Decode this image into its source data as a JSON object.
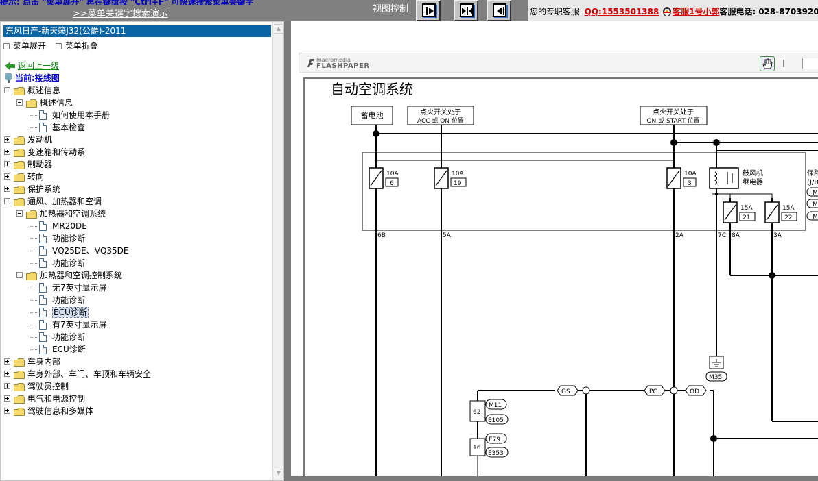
{
  "topbar": {
    "tip": "提示: 点击 \"菜单展开\" 再在键盘按 \"Ctrl+F\" 可快速搜索菜单关键字",
    "demo_link": ">>菜单关键字搜索演示",
    "view_label": "视图控制"
  },
  "service": {
    "prefix": "您的专职客服",
    "qq": "QQ:1553501388",
    "cs_name": "客服1号小郭",
    "tel_label": "客服电话:",
    "tel": "028-8703920"
  },
  "left": {
    "model": "东风日产-新天籁J32(公爵)-2011",
    "expand": "菜单展开",
    "collapse": "菜单折叠",
    "back": "返回上一级",
    "current": "当前:接线图"
  },
  "tree": [
    {
      "label": "概述信息",
      "level": 0,
      "type": "folder",
      "expanded": true
    },
    {
      "label": "概述信息",
      "level": 1,
      "type": "folder",
      "expanded": true
    },
    {
      "label": "如何使用本手册",
      "level": 2,
      "type": "doc"
    },
    {
      "label": "基本检查",
      "level": 2,
      "type": "doc"
    },
    {
      "label": "发动机",
      "level": 0,
      "type": "folder",
      "expanded": false
    },
    {
      "label": "变速箱和传动系",
      "level": 0,
      "type": "folder",
      "expanded": false
    },
    {
      "label": "制动器",
      "level": 0,
      "type": "folder",
      "expanded": false
    },
    {
      "label": "转向",
      "level": 0,
      "type": "folder",
      "expanded": false
    },
    {
      "label": "保护系统",
      "level": 0,
      "type": "folder",
      "expanded": false
    },
    {
      "label": "通风、加热器和空调",
      "level": 0,
      "type": "folder",
      "expanded": true
    },
    {
      "label": "加热器和空调系统",
      "level": 1,
      "type": "folder",
      "expanded": true
    },
    {
      "label": "MR20DE",
      "level": 2,
      "type": "doc"
    },
    {
      "label": "功能诊断",
      "level": 2,
      "type": "doc"
    },
    {
      "label": "VQ25DE、VQ35DE",
      "level": 2,
      "type": "doc"
    },
    {
      "label": "功能诊断",
      "level": 2,
      "type": "doc"
    },
    {
      "label": "加热器和空调控制系统",
      "level": 1,
      "type": "folder",
      "expanded": true
    },
    {
      "label": "无7英寸显示屏",
      "level": 2,
      "type": "doc"
    },
    {
      "label": "功能诊断",
      "level": 2,
      "type": "doc"
    },
    {
      "label": "ECU诊断",
      "level": 2,
      "type": "doc",
      "selected": true
    },
    {
      "label": "有7英寸显示屏",
      "level": 2,
      "type": "doc"
    },
    {
      "label": "功能诊断",
      "level": 2,
      "type": "doc"
    },
    {
      "label": "ECU诊断",
      "level": 2,
      "type": "doc"
    },
    {
      "label": "车身内部",
      "level": 0,
      "type": "folder",
      "expanded": false
    },
    {
      "label": "车身外部、车门、车顶和车辆安全",
      "level": 0,
      "type": "folder",
      "expanded": false
    },
    {
      "label": "驾驶员控制",
      "level": 0,
      "type": "folder",
      "expanded": false
    },
    {
      "label": "电气和电源控制",
      "level": 0,
      "type": "folder",
      "expanded": false
    },
    {
      "label": "驾驶信息和多媒体",
      "level": 0,
      "type": "folder",
      "expanded": false
    }
  ],
  "viewer": {
    "brand_small": "macromedia",
    "brand_big": "FLASHPAPER"
  },
  "diagram": {
    "title": "自动空调系统",
    "battery": "蓄电池",
    "ign1_line1": "点火开关处于",
    "ign1_line2": "ACC 或 ON 位置",
    "ign2_line1": "点火开关处于",
    "ign2_line2": "ON 或 START 位置",
    "fuse1_amp": "10A",
    "fuse1_no": "6",
    "fuse2_amp": "10A",
    "fuse2_no": "19",
    "fuse3_amp": "10A",
    "fuse3_no": "3",
    "fuse4_amp": "15A",
    "fuse4_no": "21",
    "fuse5_amp": "15A",
    "fuse5_no": "22",
    "relay_line1": "鼓风机",
    "relay_line2": "继电器",
    "side_line1": "保险",
    "side_line2": "(J/B",
    "pin_6b": "6B",
    "pin_5a": "5A",
    "pin_2a": "2A",
    "pin_7c": "7C",
    "pin_8a": "8A",
    "pin_3a": "3A",
    "ground": "M35",
    "gs": "GS",
    "pc": "PC",
    "od": "OD",
    "conn_62": "62",
    "conn_16": "16",
    "m11": "M11",
    "e105": "E105",
    "e79": "E79",
    "e353": "E353",
    "m_a": "M",
    "m_b": "M",
    "m_c": "M"
  }
}
